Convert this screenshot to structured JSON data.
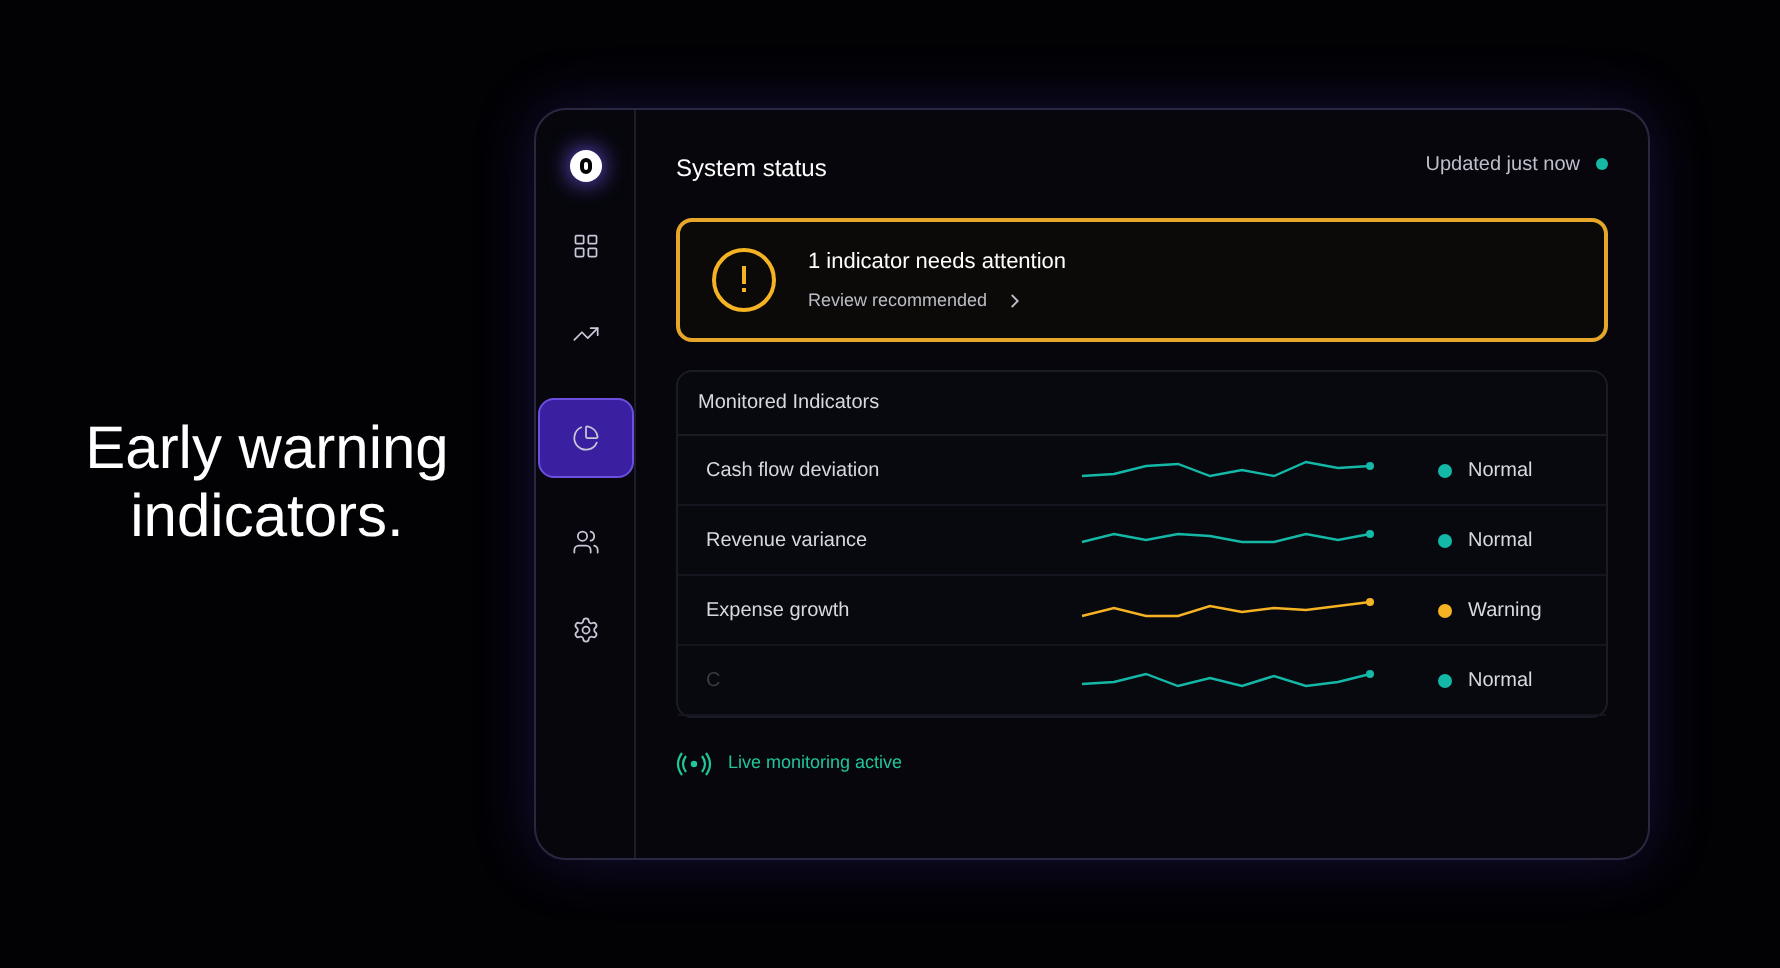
{
  "headline": "Early warning indicators.",
  "sidebar": {
    "items": [
      {
        "selected": false
      },
      {
        "selected": false
      },
      {
        "selected": true
      },
      {
        "selected": false
      },
      {
        "selected": false
      }
    ]
  },
  "header": {
    "title": "System status",
    "updated": "Updated just now"
  },
  "alert": {
    "title": "1 indicator needs attention",
    "link": "Review recommended"
  },
  "indicators": {
    "title": "Monitored Indicators",
    "rows": [
      {
        "name": "Cash flow deviation",
        "status": "Normal",
        "color": "#14b8a6",
        "faded": false
      },
      {
        "name": "Revenue variance",
        "status": "Normal",
        "color": "#14b8a6",
        "faded": false
      },
      {
        "name": "Expense growth",
        "status": "Warning",
        "color": "#f5b324",
        "faded": false
      },
      {
        "name": "C",
        "status": "Normal",
        "color": "#14b8a6",
        "faded": true
      }
    ]
  },
  "footer": {
    "text": "Live monitoring active"
  }
}
